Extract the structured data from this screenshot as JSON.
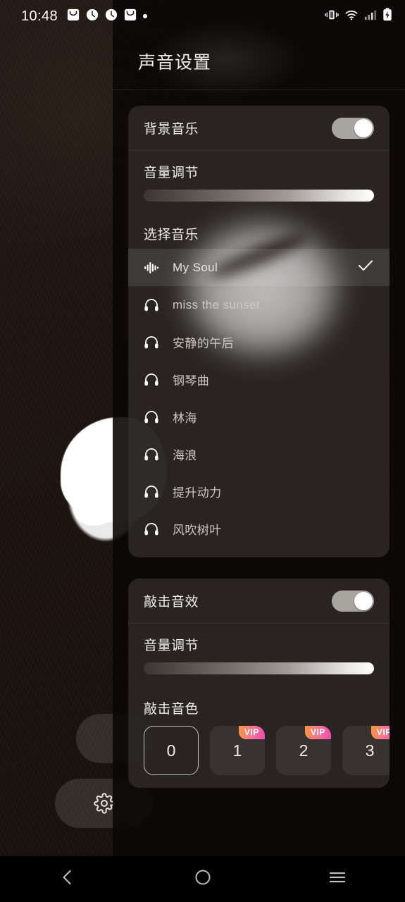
{
  "status_bar": {
    "clock": "10:48",
    "left_icons": [
      "inbox-icon",
      "clock-icon",
      "clock-icon",
      "inbox-icon",
      "dot-icon"
    ],
    "right_icons": [
      "vibrate-icon",
      "wifi-icon",
      "signal-icon",
      "battery-charging-icon"
    ]
  },
  "panel": {
    "title": "声音设置"
  },
  "bgm_card": {
    "toggle_label": "背景音乐",
    "toggle_state": "on",
    "volume_label": "音量调节",
    "volume_value": 100,
    "music_list_label": "选择音乐",
    "music_items": [
      {
        "name": "My Soul",
        "icon": "waveform-icon",
        "selected": true
      },
      {
        "name": "miss the sunset",
        "icon": "headphones-icon",
        "selected": false
      },
      {
        "name": "安静的午后",
        "icon": "headphones-icon",
        "selected": false
      },
      {
        "name": "钢琴曲",
        "icon": "headphones-icon",
        "selected": false
      },
      {
        "name": "林海",
        "icon": "headphones-icon",
        "selected": false
      },
      {
        "name": "海浪",
        "icon": "headphones-icon",
        "selected": false
      },
      {
        "name": "提升动力",
        "icon": "headphones-icon",
        "selected": false
      },
      {
        "name": "风吹树叶",
        "icon": "headphones-icon",
        "selected": false
      }
    ]
  },
  "tap_card": {
    "toggle_label": "敲击音效",
    "toggle_state": "on",
    "volume_label": "音量调节",
    "volume_value": 100,
    "timbre_label": "敲击音色",
    "timbre_tiles": [
      {
        "label": "0",
        "vip": false,
        "selected": true
      },
      {
        "label": "1",
        "vip": true,
        "selected": false
      },
      {
        "label": "2",
        "vip": true,
        "selected": false
      },
      {
        "label": "3",
        "vip": true,
        "selected": false
      }
    ],
    "vip_badge_label": "VIP"
  },
  "background_buttons": [
    {
      "name": "float-button-top",
      "icon": ""
    },
    {
      "name": "settings-float-button",
      "icon": "gear-icon"
    }
  ],
  "nav_bar": {
    "back": "back-icon",
    "home": "home-icon",
    "recents": "recents-icon"
  },
  "colors": {
    "vip_gradient_start": "#F8973A",
    "vip_gradient_end": "#EF49B0",
    "panel_bg": "#0A0807",
    "card_bg": "#342F2C",
    "accent_text": "#F0EEEC"
  }
}
